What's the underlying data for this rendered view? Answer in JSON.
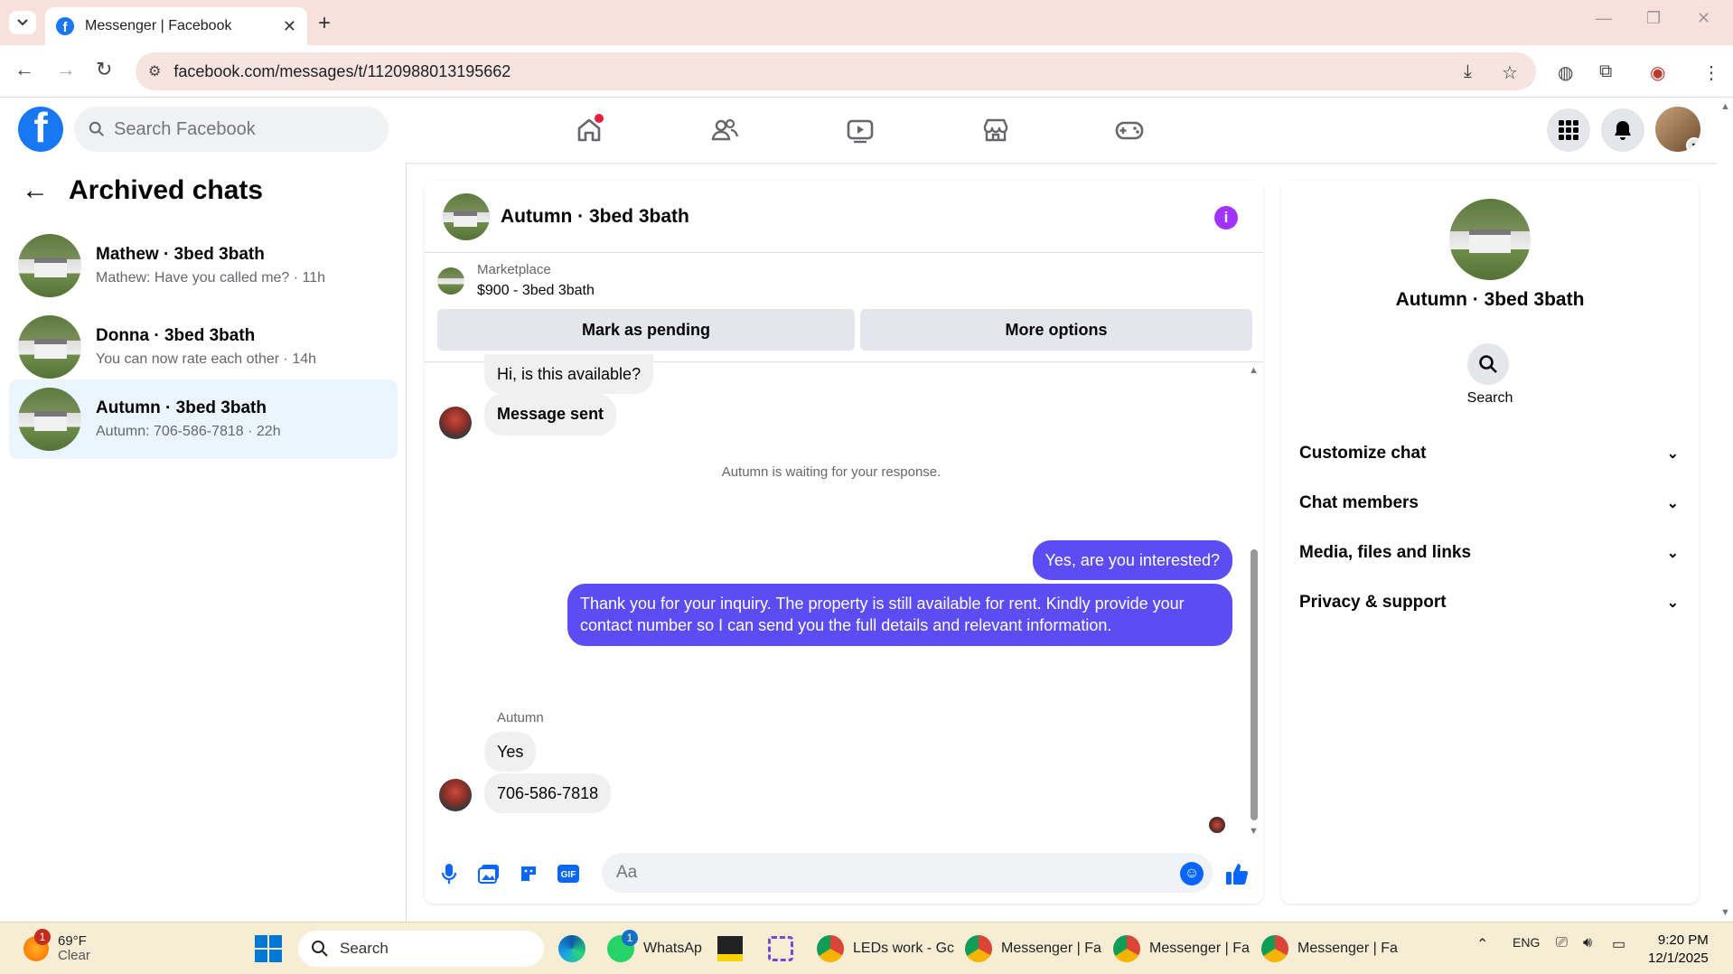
{
  "browser": {
    "tab_title": "Messenger | Facebook",
    "url": "facebook.com/messages/t/1120988013195662"
  },
  "fb_header": {
    "search_placeholder": "Search Facebook"
  },
  "left_panel": {
    "title": "Archived chats",
    "chats": [
      {
        "name": "Mathew · 3bed 3bath",
        "preview": "Mathew: Have you called me? · 11h",
        "active": false
      },
      {
        "name": "Donna · 3bed 3bath",
        "preview": "You can now rate each other · 14h",
        "active": false
      },
      {
        "name": "Autumn · 3bed 3bath",
        "preview": "Autumn: 706-586-7818 · 22h",
        "active": true
      }
    ]
  },
  "conversation": {
    "title": "Autumn · 3bed 3bath",
    "marketplace_label": "Marketplace",
    "listing": "$900 - 3bed 3bath",
    "mark_pending": "Mark as pending",
    "more_options": "More options",
    "messages": {
      "m1": "Hi, is this available?",
      "m2": "Message sent",
      "waiting_note": "Autumn is waiting for your response.",
      "m3": "Yes, are you interested?",
      "m4": "Thank you for your inquiry. The property is still available for rent. Kindly provide your contact number so I can send you the full details and relevant information.",
      "sender": "Autumn",
      "m5": "Yes",
      "m6": "706-586-7818"
    },
    "composer_placeholder": "Aa"
  },
  "right_panel": {
    "name": "Autumn · 3bed 3bath",
    "search_label": "Search",
    "sections": [
      "Customize chat",
      "Chat members",
      "Media, files and links",
      "Privacy & support"
    ]
  },
  "taskbar": {
    "weather_temp": "69°F",
    "weather_desc": "Clear",
    "weather_badge": "1",
    "search": "Search",
    "whatsapp": "WhatsAp",
    "whatsapp_badge": "1",
    "chrome1": "LEDs work - Gc",
    "chrome2": "Messenger | Fa",
    "chrome3": "Messenger | Fa",
    "chrome4": "Messenger | Fa",
    "lang": "ENG",
    "time": "9:20 PM",
    "date": "12/1/2025"
  },
  "colors": {
    "fb_blue": "#1877f2",
    "outgoing_bubble": "#5b4cf4",
    "active_chat_bg": "#ebf5ff"
  }
}
